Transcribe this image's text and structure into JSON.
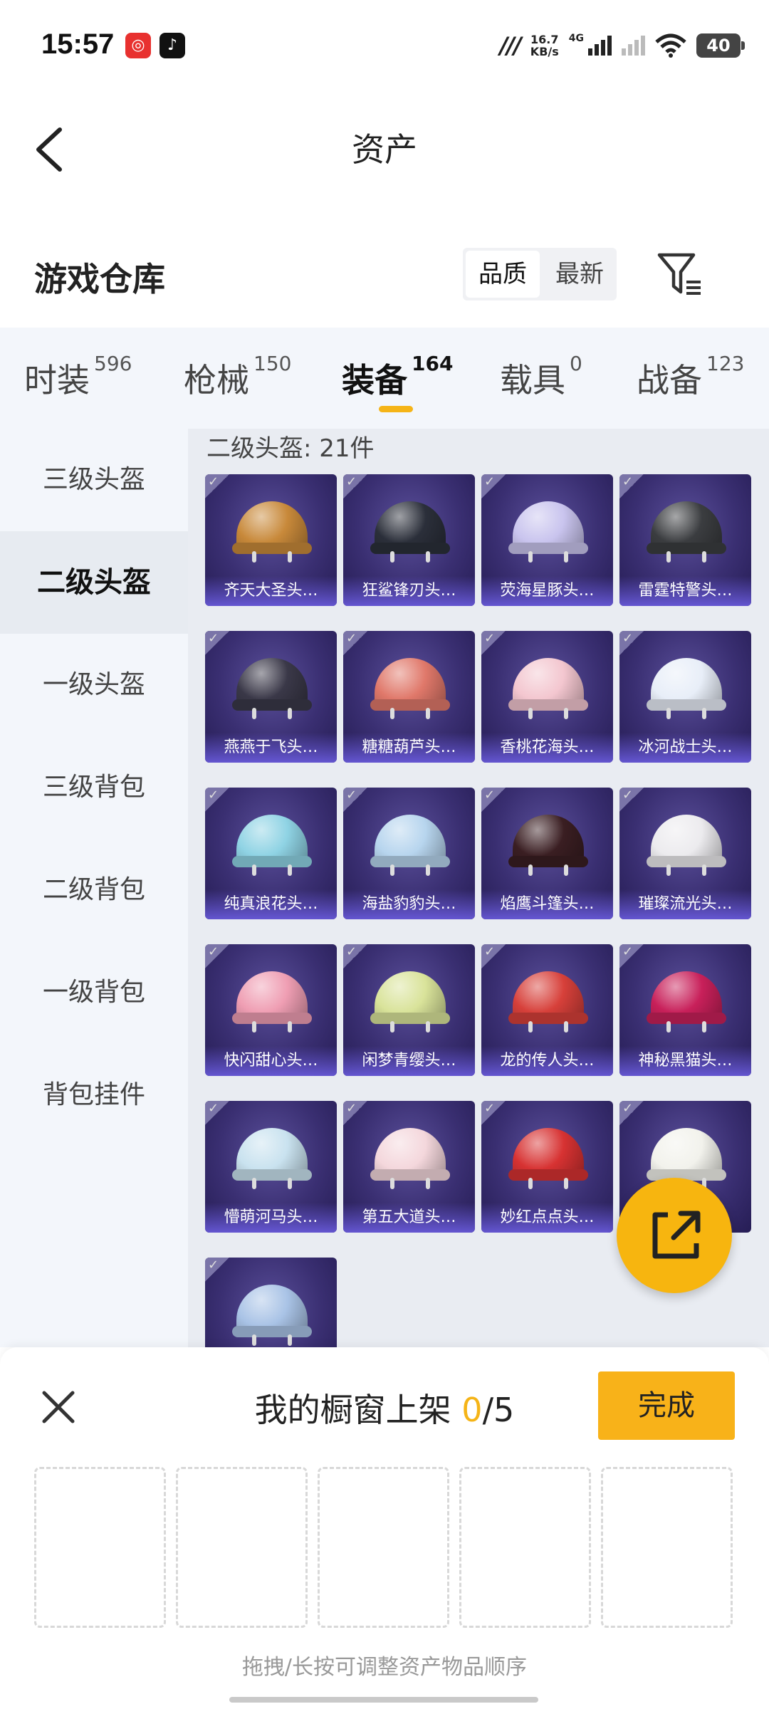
{
  "status_bar": {
    "time": "15:57",
    "net_speed_value": "16.7",
    "net_speed_unit": "KB/s",
    "network": "4G",
    "battery": "40",
    "icons": [
      "netease-music-icon",
      "douyin-icon",
      "mi-icon",
      "signal-icon",
      "wifi-icon",
      "battery-icon"
    ]
  },
  "header": {
    "title": "资产"
  },
  "warehouse": {
    "title": "游戏仓库",
    "sort_options": [
      "品质",
      "最新"
    ],
    "active_sort": "品质"
  },
  "tabs": [
    {
      "label": "时装",
      "count": "596"
    },
    {
      "label": "枪械",
      "count": "150"
    },
    {
      "label": "装备",
      "count": "164"
    },
    {
      "label": "载具",
      "count": "0"
    },
    {
      "label": "战备",
      "count": "123"
    }
  ],
  "active_tab": "装备",
  "side_nav": [
    "三级头盔",
    "二级头盔",
    "一级头盔",
    "三级背包",
    "二级背包",
    "一级背包",
    "背包挂件"
  ],
  "active_side": "二级头盔",
  "section": {
    "heading": "二级头盔: 21件"
  },
  "items": [
    {
      "name": "齐天大圣头…",
      "color": "#c8893a"
    },
    {
      "name": "狂鲨锋刃头…",
      "color": "#2b2f3a"
    },
    {
      "name": "荧海星豚头…",
      "color": "#c9c4ee"
    },
    {
      "name": "雷霆特警头…",
      "color": "#3b3d40"
    },
    {
      "name": "燕燕于飞头…",
      "color": "#3a3848"
    },
    {
      "name": "糖糖葫芦头…",
      "color": "#e0786a"
    },
    {
      "name": "香桃花海头…",
      "color": "#f3c6cf"
    },
    {
      "name": "冰河战士头…",
      "color": "#e8eef8"
    },
    {
      "name": "纯真浪花头…",
      "color": "#8fd3e4"
    },
    {
      "name": "海盐豹豹头…",
      "color": "#b7d5ee"
    },
    {
      "name": "焰鹰斗篷头…",
      "color": "#3a1e22"
    },
    {
      "name": "璀璨流光头…",
      "color": "#ecebee"
    },
    {
      "name": "快闪甜心头…",
      "color": "#ef9eb3"
    },
    {
      "name": "闲梦青缨头…",
      "color": "#d9e39a"
    },
    {
      "name": "龙的传人头…",
      "color": "#d7403a"
    },
    {
      "name": "神秘黑猫头…",
      "color": "#c8205a"
    },
    {
      "name": "懵萌河马头…",
      "color": "#c9e2ef"
    },
    {
      "name": "第五大道头…",
      "color": "#f4d7dc"
    },
    {
      "name": "妙红点点头…",
      "color": "#d73232"
    },
    {
      "name": "",
      "color": "#f2f2ec"
    },
    {
      "name": "",
      "color": "#a9c3e6"
    }
  ],
  "bottom_sheet": {
    "title_prefix": "我的橱窗上架 ",
    "count": "0",
    "total": "/5",
    "done_label": "完成",
    "slots": 5,
    "hint": "拖拽/长按可调整资产物品顺序"
  },
  "colors": {
    "accent": "#f5b417",
    "card_bg": "#3a2f72"
  }
}
